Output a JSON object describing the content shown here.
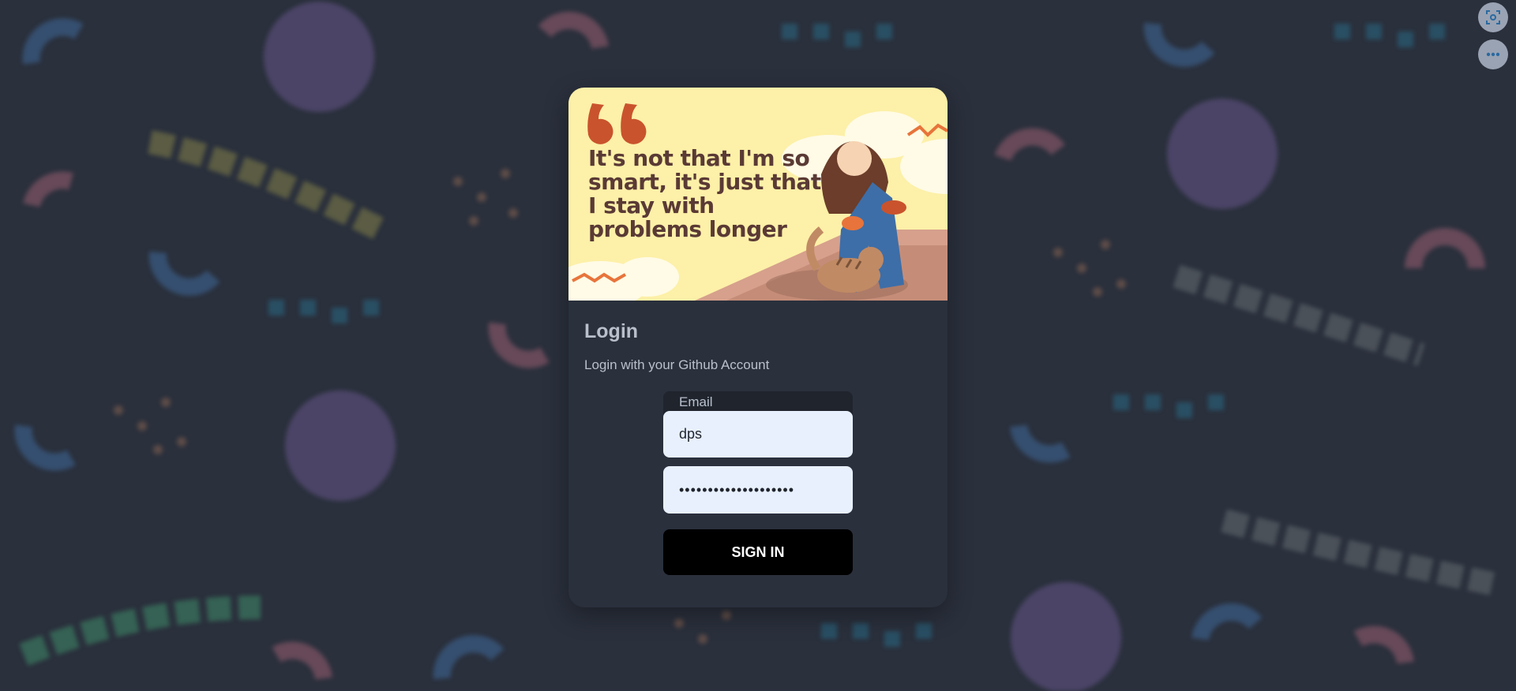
{
  "banner": {
    "quote": "It's not that I'm so smart, it's just that I stay with problems longer"
  },
  "login": {
    "title": "Login",
    "subtitle": "Login with your Github Account",
    "email_label": "Email",
    "email_value": "dps",
    "password_value": "••••••••••••••••••••",
    "signin_label": "SIGN IN"
  },
  "toolbar": {
    "icons": [
      "screenshot-icon",
      "more-icon"
    ]
  },
  "colors": {
    "background": "#2a303c",
    "banner": "#fdf0a8",
    "input": "#e8f0fe",
    "button": "#000000",
    "accent": "#e8743b"
  }
}
